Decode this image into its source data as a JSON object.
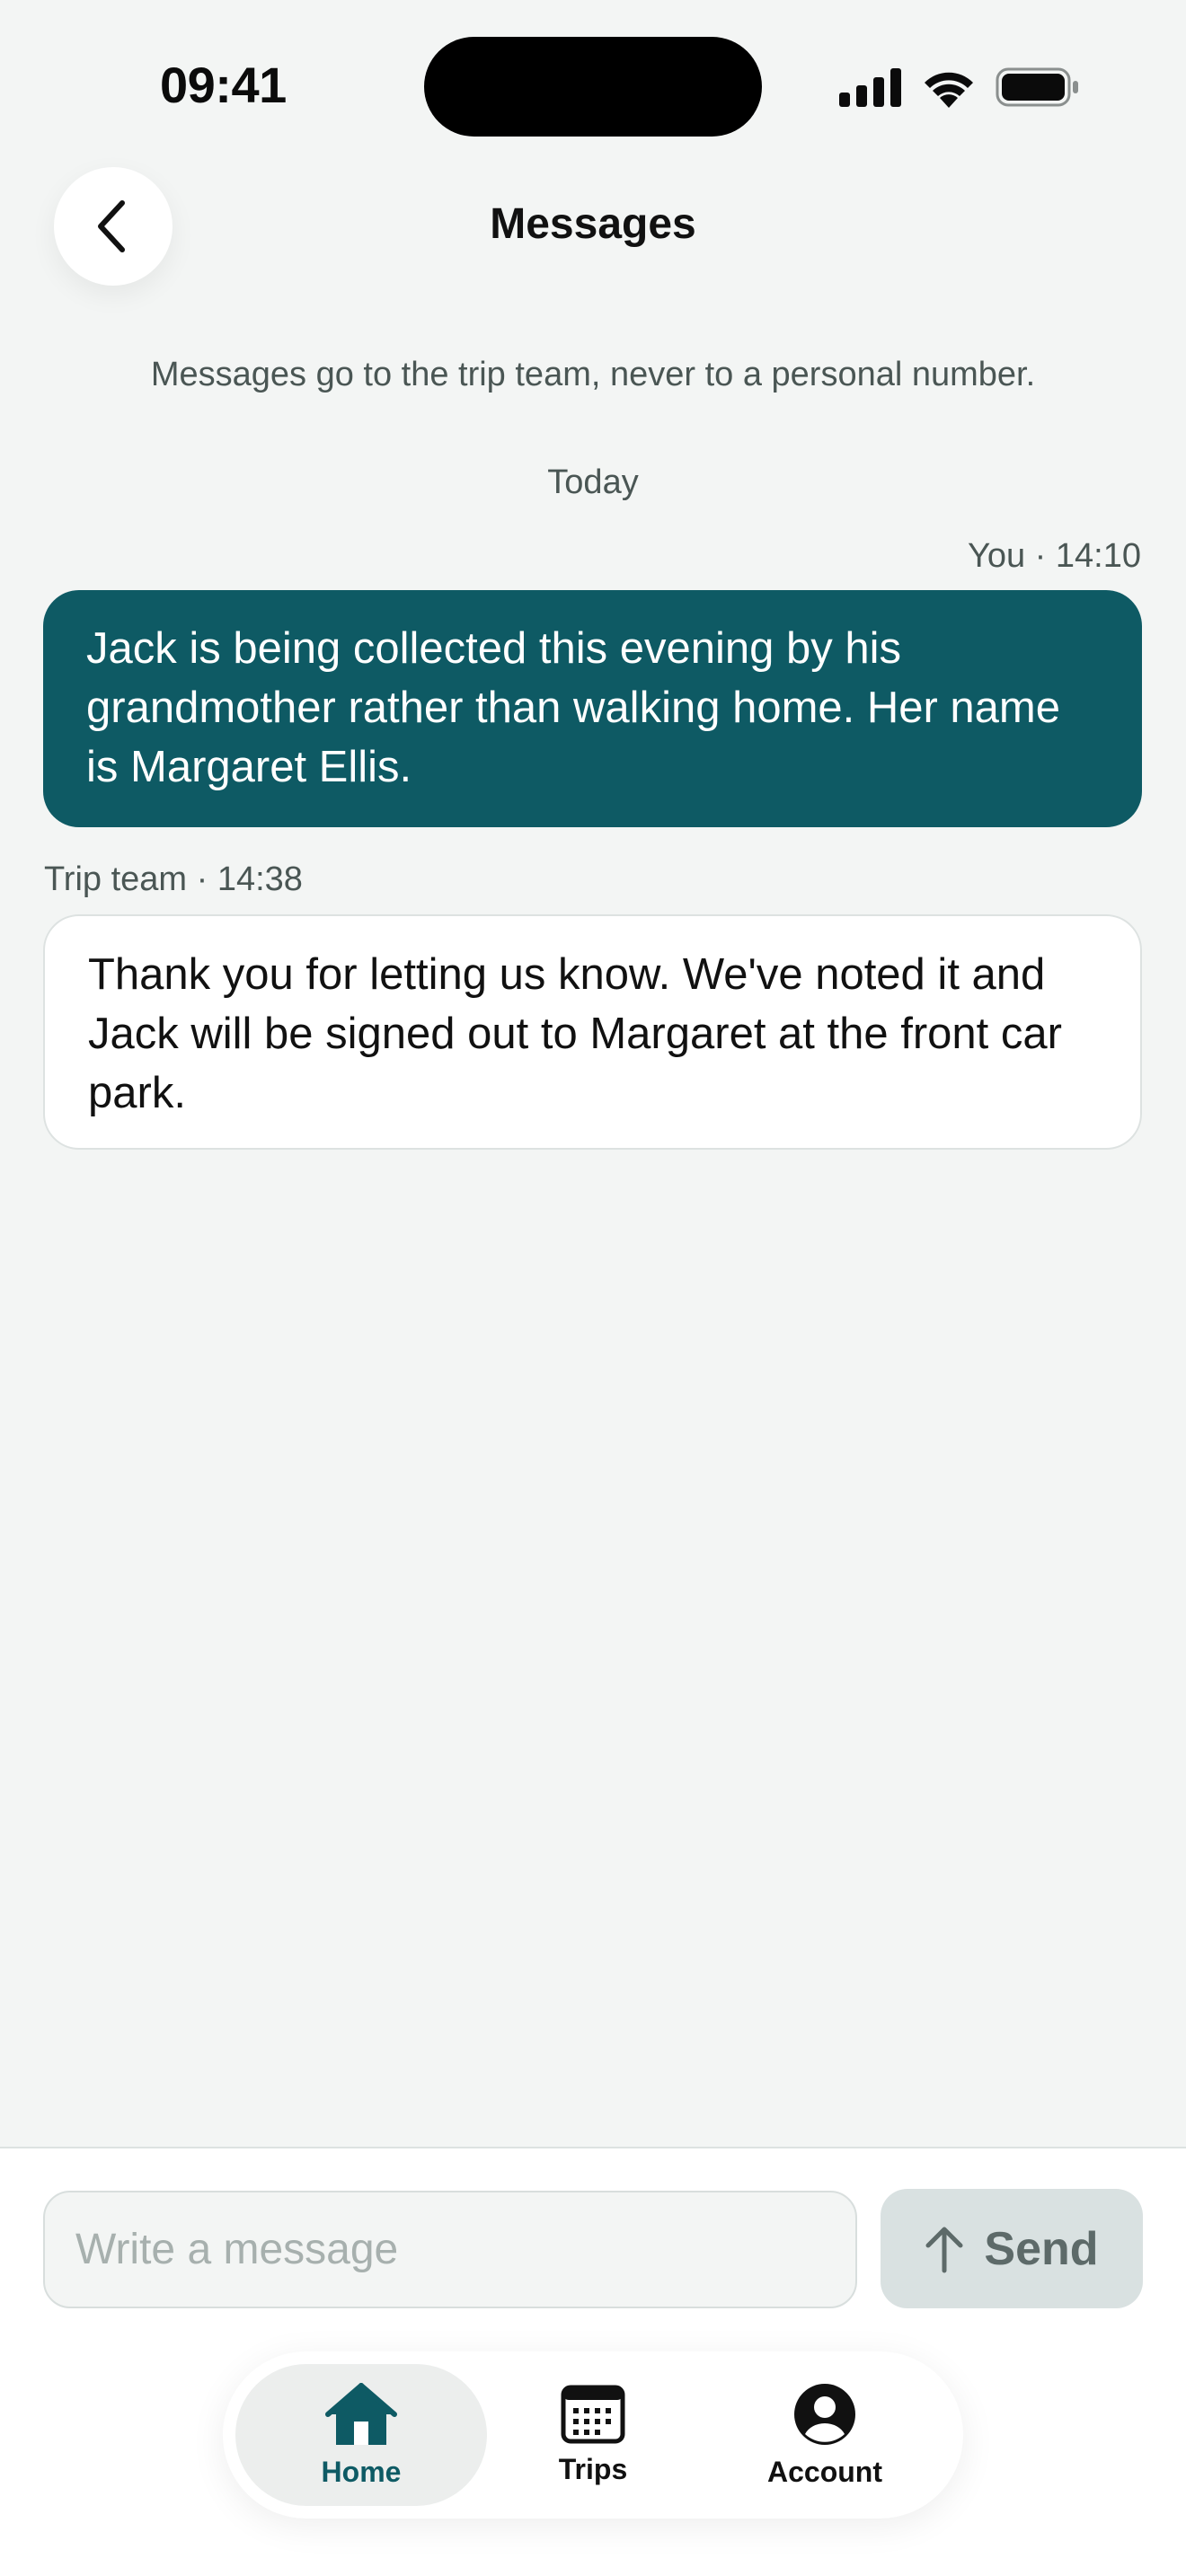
{
  "status_bar": {
    "time": "09:41"
  },
  "header": {
    "title": "Messages"
  },
  "notice": "Messages go to the trip team, never to a personal number.",
  "day_label": "Today",
  "messages": [
    {
      "direction": "outgoing",
      "meta": "You · 14:10",
      "text": "Jack is being collected this evening by his grandmother rather than walking home. Her name is Margaret Ellis."
    },
    {
      "direction": "incoming",
      "meta": "Trip team · 14:38",
      "text": "Thank you for letting us know. We've noted it and Jack will be signed out to Margaret at the front car park."
    }
  ],
  "composer": {
    "placeholder": "Write a message",
    "value": "",
    "send_label": "Send"
  },
  "tabs": [
    {
      "label": "Home",
      "icon": "home-icon",
      "active": true
    },
    {
      "label": "Trips",
      "icon": "calendar-icon",
      "active": false
    },
    {
      "label": "Account",
      "icon": "account-icon",
      "active": false
    }
  ],
  "colors": {
    "accent": "#0e5a64",
    "background": "#f3f5f4",
    "muted_text": "#4a5654"
  }
}
